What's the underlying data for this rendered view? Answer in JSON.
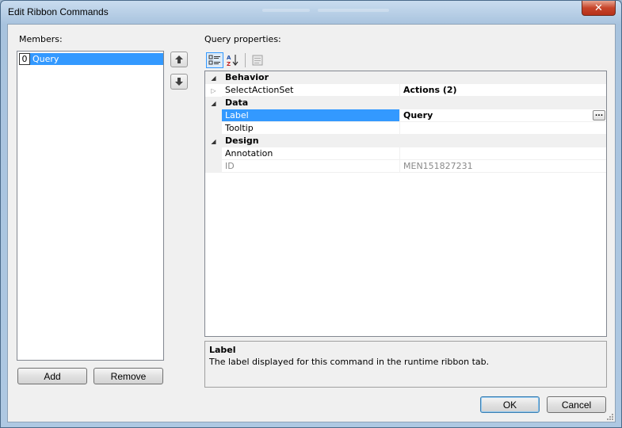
{
  "window": {
    "title": "Edit Ribbon Commands",
    "close_glyph": "✕"
  },
  "members": {
    "label": "Members:",
    "items": [
      {
        "index": "0",
        "label": "Query"
      }
    ],
    "add_label": "Add",
    "remove_label": "Remove"
  },
  "query": {
    "label": "Query properties:",
    "categories": [
      {
        "name": "Behavior",
        "rows": [
          {
            "name": "SelectActionSet",
            "value": "Actions (2)",
            "value_bold": true,
            "expandable": true
          }
        ]
      },
      {
        "name": "Data",
        "rows": [
          {
            "name": "Label",
            "value": "Query",
            "value_bold": true,
            "selected": true,
            "has_ellipsis": true
          },
          {
            "name": "Tooltip",
            "value": ""
          }
        ]
      },
      {
        "name": "Design",
        "rows": [
          {
            "name": "Annotation",
            "value": ""
          },
          {
            "name": "ID",
            "value": "MEN151827231",
            "readonly": true
          }
        ]
      }
    ],
    "ellipsis_label": "...",
    "help_title": "Label",
    "help_text": "The label displayed for this command in the runtime ribbon tab."
  },
  "dialog": {
    "ok_label": "OK",
    "cancel_label": "Cancel"
  },
  "colors": {
    "selection": "#3399ff",
    "close": "#c7452a"
  }
}
